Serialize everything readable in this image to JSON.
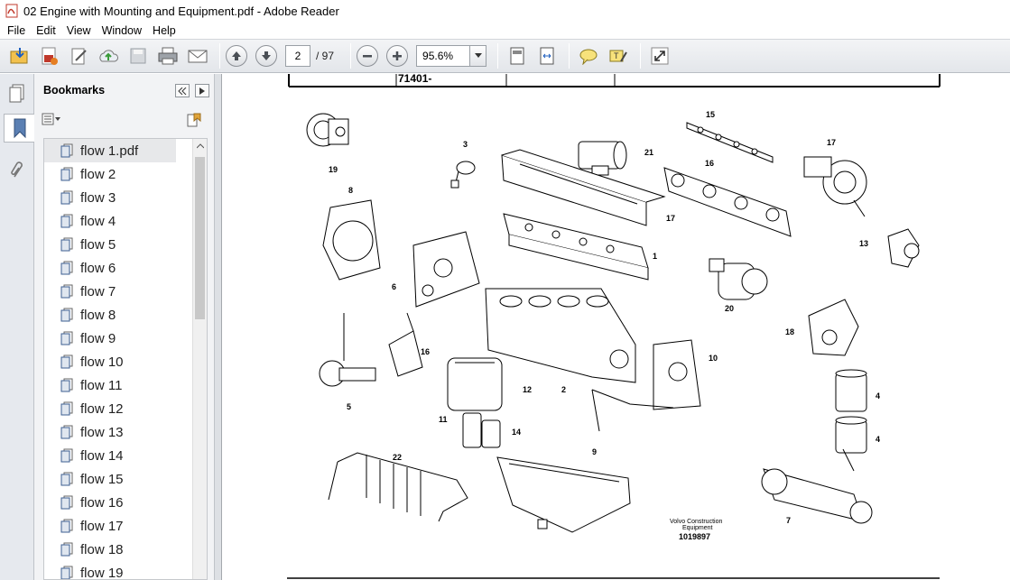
{
  "window": {
    "title": "02 Engine with Mounting and Equipment.pdf - Adobe Reader"
  },
  "menu": [
    "File",
    "Edit",
    "View",
    "Window",
    "Help"
  ],
  "toolbar": {
    "page_current": "2",
    "page_total": "/ 97",
    "zoom": "95.6%"
  },
  "bookmarks": {
    "title": "Bookmarks",
    "items": [
      "flow 1.pdf",
      "flow 2",
      "flow 3",
      "flow 4",
      "flow 5",
      "flow 6",
      "flow 7",
      "flow 8",
      "flow 9",
      "flow 10",
      "flow 11",
      "flow 12",
      "flow 13",
      "flow 14",
      "flow 15",
      "flow 16",
      "flow 17",
      "flow 18",
      "flow 19"
    ]
  },
  "document": {
    "table_cell": "71401-",
    "caption_line1": "Volvo Construction",
    "caption_line2": "Equipment",
    "drawing_id": "1019897",
    "part_numbers": [
      "19",
      "3",
      "21",
      "15",
      "17",
      "16",
      "8",
      "17",
      "1",
      "13",
      "6",
      "20",
      "18",
      "16",
      "10",
      "12",
      "2",
      "5",
      "11",
      "14",
      "4",
      "4",
      "22",
      "9",
      "7"
    ]
  }
}
